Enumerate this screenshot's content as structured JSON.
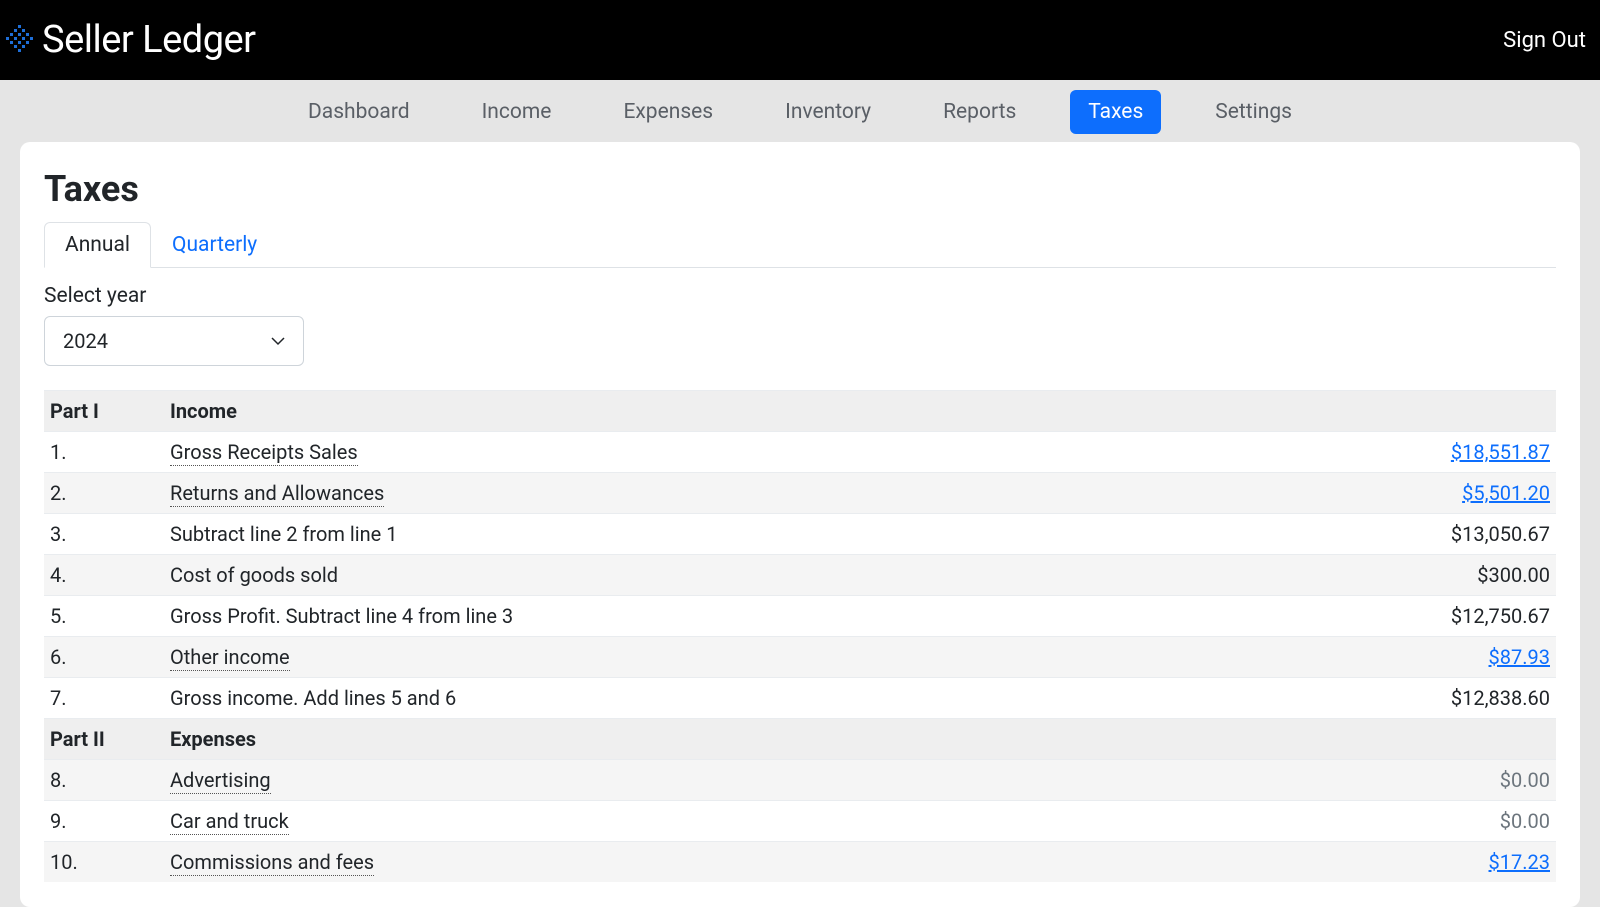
{
  "brand": {
    "title": "Seller Ledger"
  },
  "header": {
    "signout": "Sign Out"
  },
  "nav": {
    "items": [
      {
        "label": "Dashboard"
      },
      {
        "label": "Income"
      },
      {
        "label": "Expenses"
      },
      {
        "label": "Inventory"
      },
      {
        "label": "Reports"
      },
      {
        "label": "Taxes"
      },
      {
        "label": "Settings"
      }
    ],
    "active_index": 5
  },
  "page": {
    "title": "Taxes"
  },
  "tabs": {
    "annual": "Annual",
    "quarterly": "Quarterly",
    "active": "annual"
  },
  "year": {
    "label": "Select year",
    "value": "2024"
  },
  "sections": [
    {
      "part": "Part I",
      "heading": "Income",
      "rows": [
        {
          "num": "1.",
          "desc": "Gross Receipts Sales",
          "amount": "$18,551.87",
          "dotted": true,
          "link": true,
          "muted": false
        },
        {
          "num": "2.",
          "desc": "Returns and Allowances",
          "amount": "$5,501.20",
          "dotted": true,
          "link": true,
          "muted": false
        },
        {
          "num": "3.",
          "desc": "Subtract line 2 from line 1",
          "amount": "$13,050.67",
          "dotted": false,
          "link": false,
          "muted": false
        },
        {
          "num": "4.",
          "desc": "Cost of goods sold",
          "amount": "$300.00",
          "dotted": false,
          "link": false,
          "muted": false
        },
        {
          "num": "5.",
          "desc": "Gross Profit. Subtract line 4 from line 3",
          "amount": "$12,750.67",
          "dotted": false,
          "link": false,
          "muted": false
        },
        {
          "num": "6.",
          "desc": "Other income",
          "amount": "$87.93",
          "dotted": true,
          "link": true,
          "muted": false
        },
        {
          "num": "7.",
          "desc": "Gross income. Add lines 5 and 6",
          "amount": "$12,838.60",
          "dotted": false,
          "link": false,
          "muted": false
        }
      ]
    },
    {
      "part": "Part II",
      "heading": "Expenses",
      "rows": [
        {
          "num": "8.",
          "desc": "Advertising",
          "amount": "$0.00",
          "dotted": true,
          "link": false,
          "muted": true
        },
        {
          "num": "9.",
          "desc": "Car and truck",
          "amount": "$0.00",
          "dotted": true,
          "link": false,
          "muted": true
        },
        {
          "num": "10.",
          "desc": "Commissions and fees",
          "amount": "$17.23",
          "dotted": true,
          "link": true,
          "muted": false
        }
      ]
    }
  ]
}
